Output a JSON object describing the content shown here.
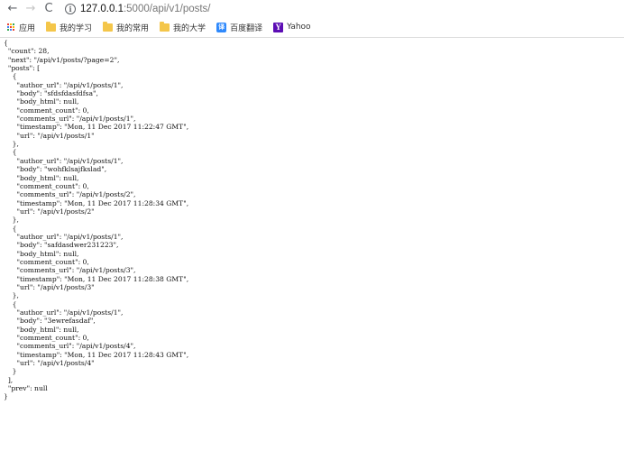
{
  "browser": {
    "url_host": "127.0.0.1",
    "url_rest": ":5000/api/v1/posts/",
    "back_icon": "←",
    "forward_icon": "→",
    "reload_icon": "C",
    "info_icon": "i"
  },
  "bookmarks": [
    {
      "label": "应用",
      "icon": "apps-grid-icon"
    },
    {
      "label": "我的学习",
      "icon": "folder-icon"
    },
    {
      "label": "我的常用",
      "icon": "folder-icon"
    },
    {
      "label": "我的大学",
      "icon": "folder-icon"
    },
    {
      "label": "百度翻译",
      "icon": "baidu-translate-icon",
      "icon_text": "译"
    },
    {
      "label": "Yahoo",
      "icon": "yahoo-icon",
      "icon_text": "Y"
    }
  ],
  "json_lines": [
    "{",
    "  \"count\": 28,",
    "  \"next\": \"/api/v1/posts/?page=2\",",
    "  \"posts\": [",
    "    {",
    "      \"author_url\": \"/api/v1/posts/1\",",
    "      \"body\": \"sfdsfdasfdfsa\",",
    "      \"body_html\": null,",
    "      \"comment_count\": 0,",
    "      \"comments_url\": \"/api/v1/posts/1\",",
    "      \"timestamp\": \"Mon, 11 Dec 2017 11:22:47 GMT\",",
    "      \"url\": \"/api/v1/posts/1\"",
    "    },",
    "    {",
    "      \"author_url\": \"/api/v1/posts/1\",",
    "      \"body\": \"wohfklsajfkslad\",",
    "      \"body_html\": null,",
    "      \"comment_count\": 0,",
    "      \"comments_url\": \"/api/v1/posts/2\",",
    "      \"timestamp\": \"Mon, 11 Dec 2017 11:28:34 GMT\",",
    "      \"url\": \"/api/v1/posts/2\"",
    "    },",
    "    {",
    "      \"author_url\": \"/api/v1/posts/1\",",
    "      \"body\": \"safdasdwer231223\",",
    "      \"body_html\": null,",
    "      \"comment_count\": 0,",
    "      \"comments_url\": \"/api/v1/posts/3\",",
    "      \"timestamp\": \"Mon, 11 Dec 2017 11:28:38 GMT\",",
    "      \"url\": \"/api/v1/posts/3\"",
    "    },",
    "    {",
    "      \"author_url\": \"/api/v1/posts/1\",",
    "      \"body\": \"3ewrefasdaf\",",
    "      \"body_html\": null,",
    "      \"comment_count\": 0,",
    "      \"comments_url\": \"/api/v1/posts/4\",",
    "      \"timestamp\": \"Mon, 11 Dec 2017 11:28:43 GMT\",",
    "      \"url\": \"/api/v1/posts/4\"",
    "    }",
    "  ],",
    "  \"prev\": null",
    "}"
  ],
  "colors": {
    "folder": "#f4c64a",
    "baidu": "#2f89fc",
    "yahoo": "#5c0db4",
    "apps_grid": [
      "#ea4335",
      "#fbbc05",
      "#34a853",
      "#4285f4"
    ]
  }
}
